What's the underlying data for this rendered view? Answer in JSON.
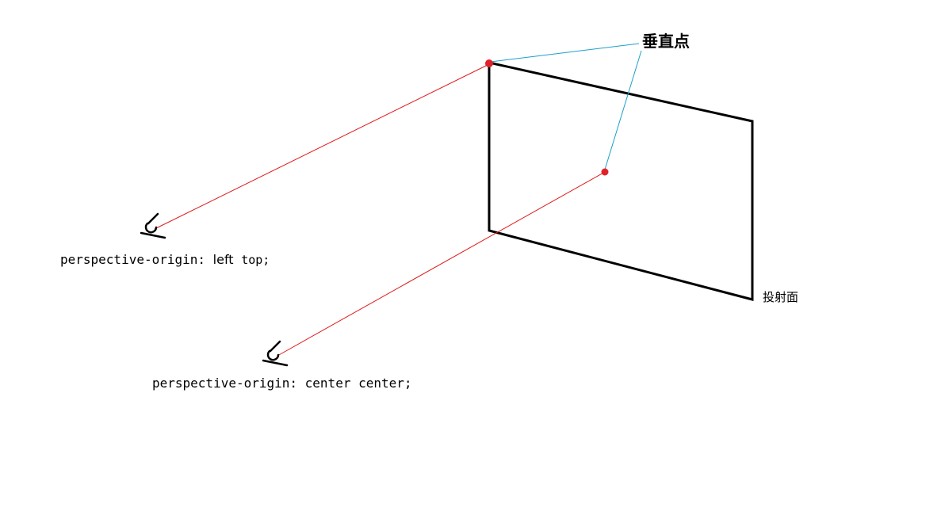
{
  "labels": {
    "vertical_point": "垂直点",
    "projection_plane": "投射面",
    "origin_left_top": {
      "prefix": "perspective-origin: ",
      "x": "left",
      "y": "top;"
    },
    "origin_center": {
      "text": "perspective-origin: center center;"
    }
  },
  "colors": {
    "sight_line": "#e01b1b",
    "pointer_line": "#1aa0c8",
    "plane": "#000000",
    "point": "#e0202a",
    "eye": "#000000"
  },
  "icons": {
    "eye_top": "eye-icon",
    "eye_bottom": "eye-icon"
  }
}
